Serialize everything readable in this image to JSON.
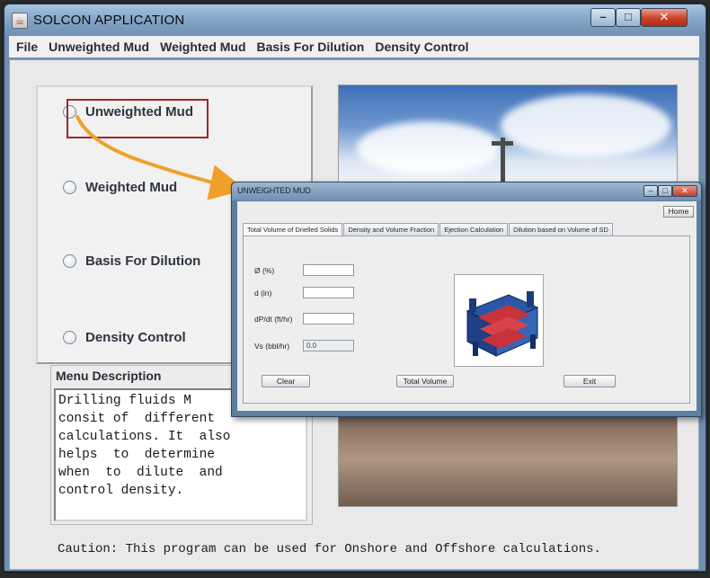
{
  "window": {
    "title": "SOLCON APPLICATION",
    "app_icon": "java-app-icon",
    "min": "–",
    "max": "□",
    "close": "✕"
  },
  "menubar": [
    "File",
    "Unweighted Mud",
    "Weighted Mud",
    "Basis For Dilution",
    "Density Control"
  ],
  "radio_options": [
    "Unweighted Mud",
    "Weighted Mud",
    "Basis For Dilution",
    "Density Control"
  ],
  "menu_description": {
    "title": "Menu Description",
    "text": "Drilling fluids M\nconsit of  different\ncalculations. It  also\nhelps  to  determine\nwhen  to  dilute  and\ncontrol density."
  },
  "caption": "Caution: This program can be used for Onshore and Offshore calculations.",
  "child_window": {
    "title": "UNWEIGHTED MUD",
    "home_label": "Home",
    "tabs": [
      "Total Volume of Drielled Solids",
      "Density and Volume Fraction",
      "Ejection Calculation",
      "Dilution based on Volume of SD"
    ],
    "fields": [
      {
        "label": "Ø (%)",
        "value": ""
      },
      {
        "label": "d (in)",
        "value": ""
      },
      {
        "label": "dP/dt (ft/hr)",
        "value": ""
      },
      {
        "label": "Vs (bbl/hr)",
        "value": "0.0"
      }
    ],
    "buttons": {
      "clear": "Clear",
      "total_volume": "Total Volume",
      "exit": "Exit"
    }
  },
  "colors": {
    "highlight_box": "#a3262a",
    "arrow": "#f0a02a",
    "title_bar": "#86a6c8"
  }
}
